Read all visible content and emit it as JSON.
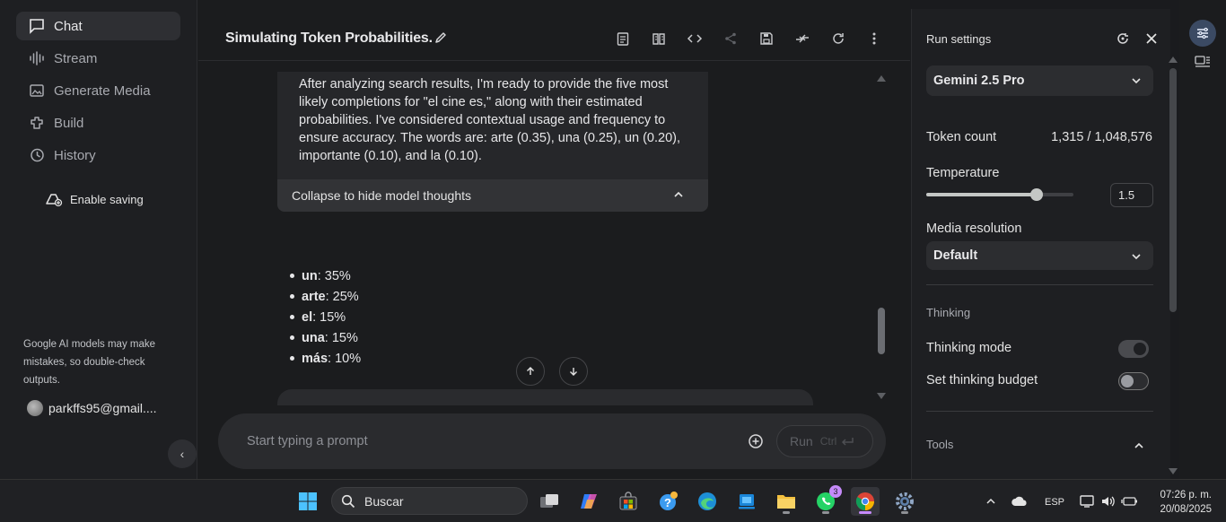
{
  "sidebar": {
    "items": [
      {
        "label": "Chat",
        "icon": "chat-icon",
        "active": true
      },
      {
        "label": "Stream",
        "icon": "stream-icon",
        "active": false
      },
      {
        "label": "Generate Media",
        "icon": "media-icon",
        "active": false
      },
      {
        "label": "Build",
        "icon": "build-icon",
        "active": false
      },
      {
        "label": "History",
        "icon": "history-icon",
        "active": false
      }
    ],
    "enable_saving": "Enable saving",
    "disclaimer": "Google AI models may make mistakes, so double-check outputs.",
    "account": "parkffs95@gmail...."
  },
  "header": {
    "title": "Simulating Token Probabilities."
  },
  "thoughts": {
    "text": "After analyzing search results, I'm ready to provide the five most likely completions for \"el cine es,\" along with their estimated probabilities. I've considered contextual usage and frequency to ensure accuracy. The words are: arte (0.35), una (0.25), un (0.20), importante (0.10), and la (0.10).",
    "collapse_label": "Collapse to hide model thoughts"
  },
  "results": [
    {
      "word": "un",
      "value": ": 35%"
    },
    {
      "word": "arte",
      "value": ": 25%"
    },
    {
      "word": "el",
      "value": ": 15%"
    },
    {
      "word": "una",
      "value": ": 15%"
    },
    {
      "word": "más",
      "value": ": 10%"
    }
  ],
  "prompt": {
    "placeholder": "Start typing a prompt",
    "run_label": "Run",
    "shortcut": "Ctrl"
  },
  "settings": {
    "title": "Run settings",
    "model": "Gemini 2.5 Pro",
    "token_count_label": "Token count",
    "token_count_value": "1,315 / 1,048,576",
    "temperature_label": "Temperature",
    "temperature_value": "1.5",
    "temperature_level": 0.75,
    "media_resolution_label": "Media resolution",
    "media_resolution_value": "Default",
    "thinking_section": "Thinking",
    "thinking_mode_label": "Thinking mode",
    "thinking_mode_on": true,
    "thinking_budget_label": "Set thinking budget",
    "thinking_budget_on": false,
    "tools_section": "Tools"
  },
  "taskbar": {
    "search_label": "Buscar",
    "language": "ESP",
    "time": "07:26 p. m.",
    "date": "20/08/2025",
    "whatsapp_badge": "3"
  },
  "colors": {
    "accent": "#3b4a63",
    "background": "#1b1c1e",
    "surface": "#2c2d30"
  }
}
